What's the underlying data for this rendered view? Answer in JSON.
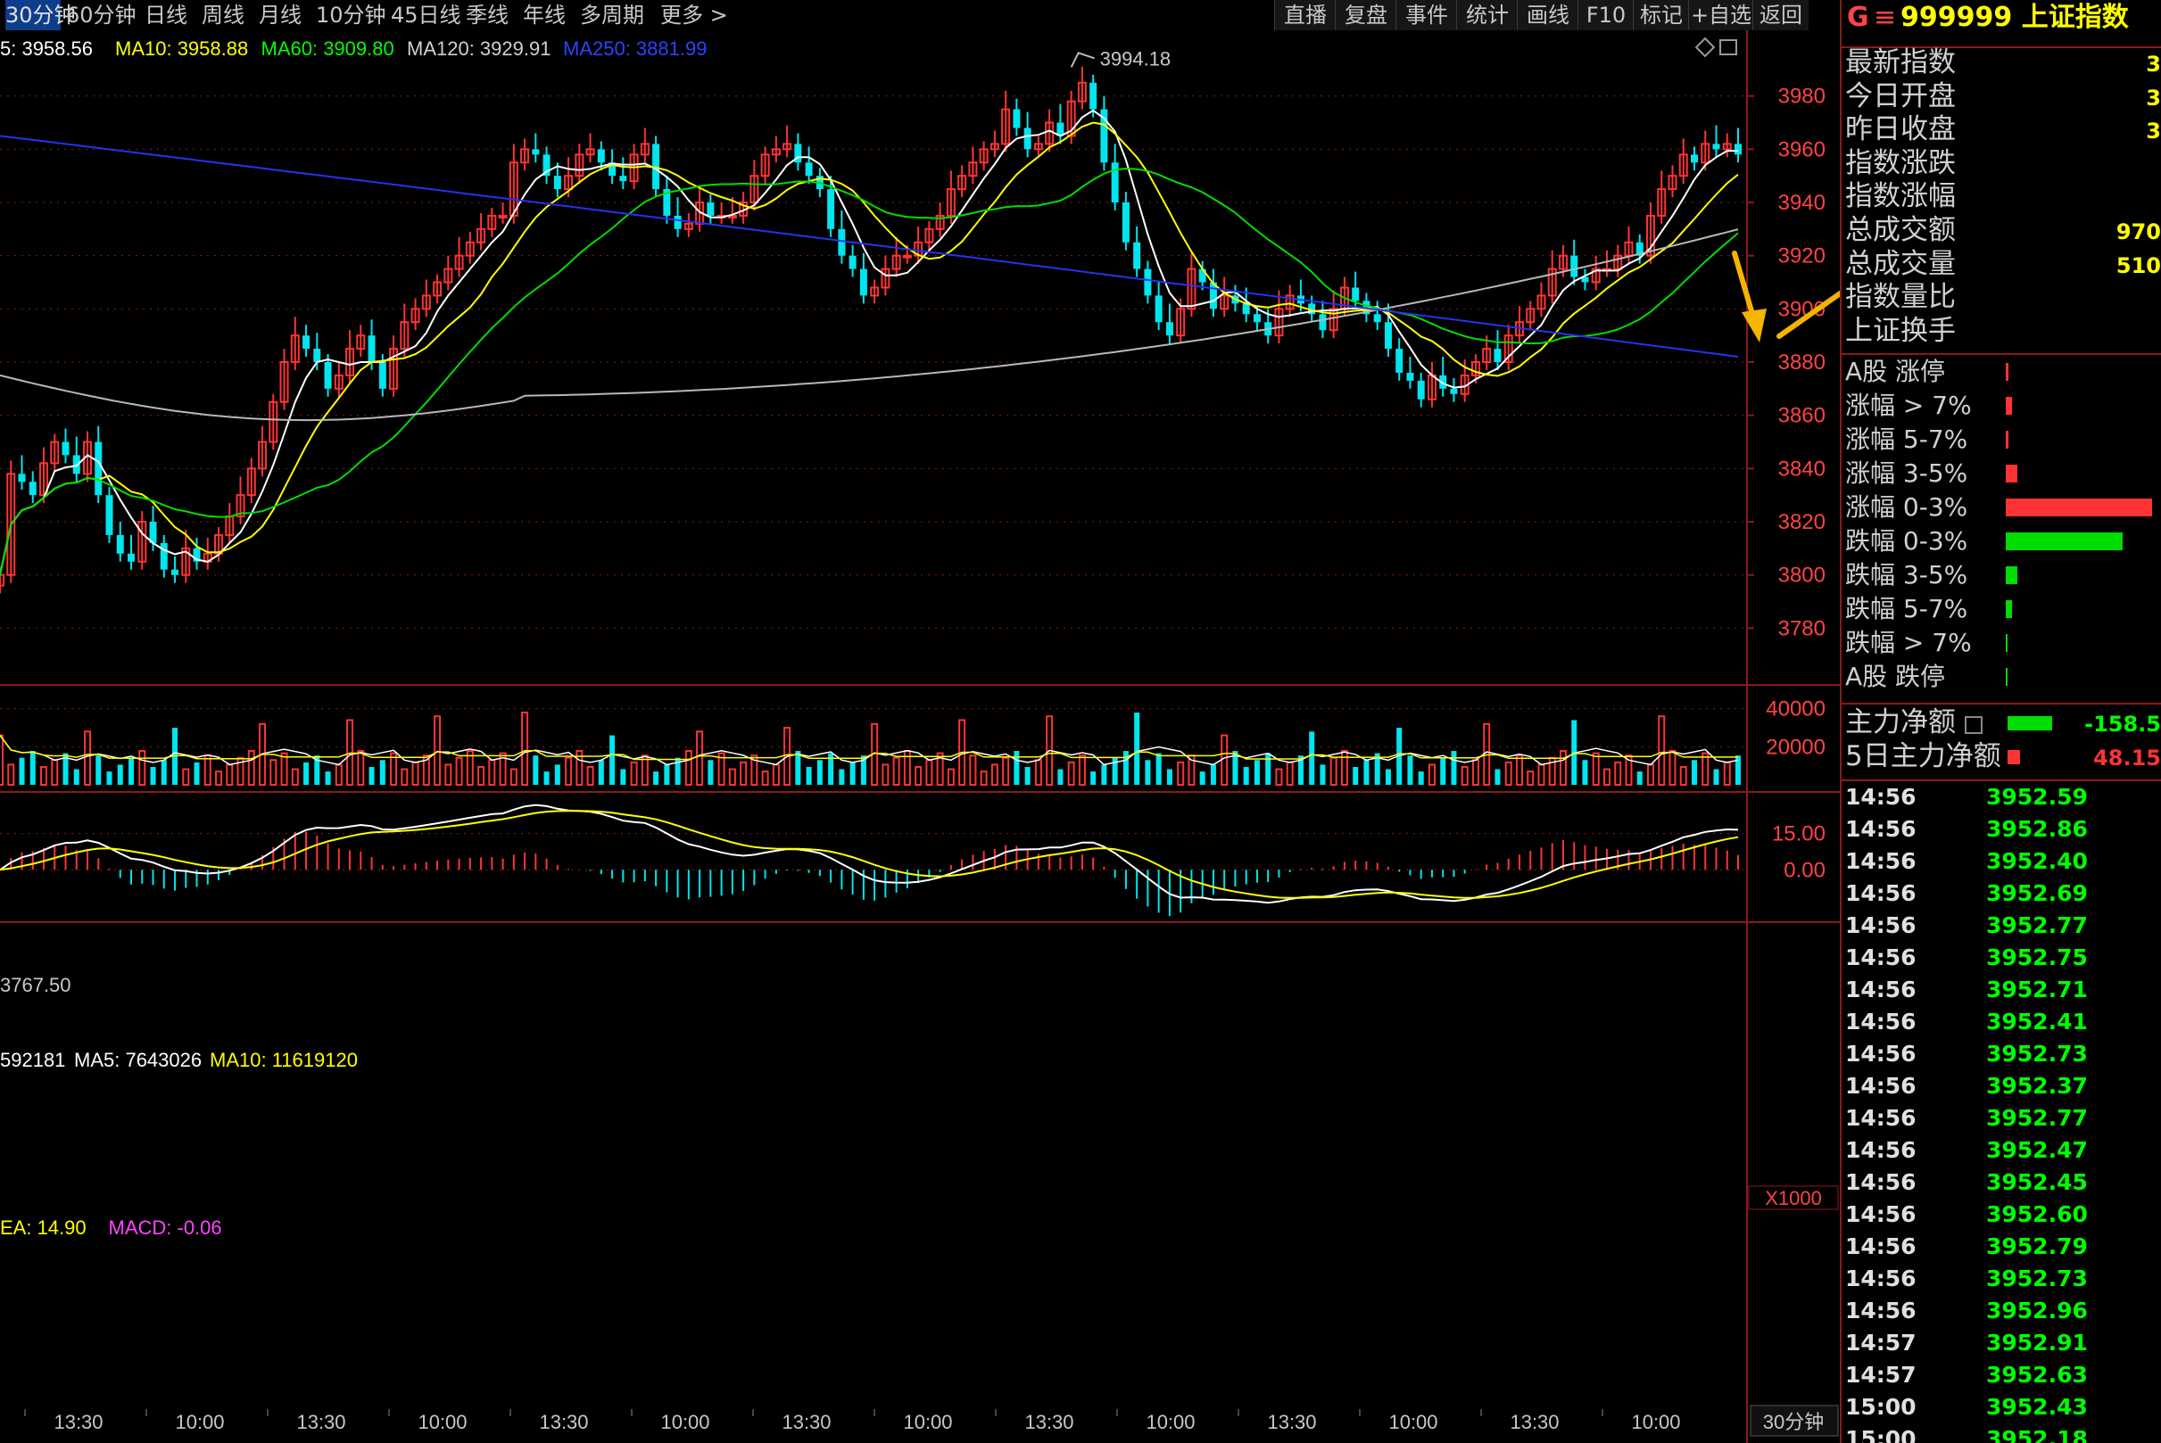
{
  "periods": [
    "30分钟",
    "60分钟",
    "日线",
    "周线",
    "月线",
    "10分钟",
    "45日线",
    "季线",
    "年线",
    "多周期",
    "更多 >"
  ],
  "active_period": "30分钟",
  "tools": [
    "直播",
    "复盘",
    "事件",
    "统计",
    "画线",
    "F10",
    "标记",
    "+自选",
    "返回"
  ],
  "main_legend": [
    {
      "text": "5: 3958.56",
      "color": "#ffffff"
    },
    {
      "text": "MA10: 3958.88",
      "color": "#ffff00"
    },
    {
      "text": "MA60: 3909.80",
      "color": "#00ff00"
    },
    {
      "text": "MA120: 3929.91",
      "color": "#d0d0d0"
    },
    {
      "text": "MA250: 3881.99",
      "color": "#2a44ff"
    }
  ],
  "high_label": "3994.18",
  "low_label": "3767.50",
  "price_ticks": [
    "3980",
    "3960",
    "3940",
    "3920",
    "3900",
    "3880",
    "3860",
    "3840",
    "3820",
    "3800",
    "3780"
  ],
  "vol_legend": [
    {
      "text": "592181",
      "color": "#ffffff"
    },
    {
      "text": "MA5: 7643026",
      "color": "#ffffff"
    },
    {
      "text": "MA10: 11619120",
      "color": "#ffff00"
    }
  ],
  "vol_ticks": [
    "40000",
    "20000"
  ],
  "vol_unit": "X1000",
  "macd_legend": [
    {
      "text": "EA: 14.90",
      "color": "#ffff00"
    },
    {
      "text": "MACD: -0.06",
      "color": "#ff44ff"
    }
  ],
  "macd_ticks": [
    "15.00",
    "0.00"
  ],
  "time_labels": [
    "13:30",
    "10:00",
    "13:30",
    "10:00",
    "13:30",
    "10:00",
    "13:30",
    "10:00",
    "13:30",
    "10:00",
    "13:30",
    "10:00",
    "13:30",
    "10:00"
  ],
  "period_label": "30分钟",
  "panel": {
    "title_letter": "G",
    "title_menu": "≡",
    "title": "999999 上证指数",
    "stats": [
      {
        "label": "最新指数",
        "value": "3"
      },
      {
        "label": "今日开盘",
        "value": "3"
      },
      {
        "label": "昨日收盘",
        "value": "3"
      },
      {
        "label": "指数涨跌",
        "value": ""
      },
      {
        "label": "指数涨幅",
        "value": ""
      },
      {
        "label": "总成交额",
        "value": "970"
      },
      {
        "label": "总成交量",
        "value": "510"
      },
      {
        "label": "指数量比",
        "value": ""
      },
      {
        "label": "上证换手",
        "value": ""
      }
    ],
    "distribution": [
      {
        "label": "A股 涨停",
        "frac": 0.02,
        "color": "#ff3333"
      },
      {
        "label": "涨幅 > 7%",
        "frac": 0.04,
        "color": "#ff3333"
      },
      {
        "label": "涨幅 5-7%",
        "frac": 0.02,
        "color": "#ff3333"
      },
      {
        "label": "涨幅 3-5%",
        "frac": 0.08,
        "color": "#ff3333"
      },
      {
        "label": "涨幅 0-3%",
        "frac": 1.0,
        "color": "#ff3333"
      },
      {
        "label": "跌幅 0-3%",
        "frac": 0.8,
        "color": "#00dd00"
      },
      {
        "label": "跌幅 3-5%",
        "frac": 0.08,
        "color": "#00dd00"
      },
      {
        "label": "跌幅 5-7%",
        "frac": 0.04,
        "color": "#00dd00"
      },
      {
        "label": "跌幅 > 7%",
        "frac": 0.01,
        "color": "#00dd00"
      },
      {
        "label": "A股 跌停",
        "frac": 0.01,
        "color": "#00dd00"
      }
    ],
    "main_net": {
      "label": "主力净额",
      "value": "-158.5"
    },
    "main_net_5d": {
      "label": "5日主力净额",
      "value": "48.15"
    },
    "ticks": [
      {
        "time": "14:56",
        "price": "3952.59"
      },
      {
        "time": "14:56",
        "price": "3952.86"
      },
      {
        "time": "14:56",
        "price": "3952.40"
      },
      {
        "time": "14:56",
        "price": "3952.69"
      },
      {
        "time": "14:56",
        "price": "3952.77"
      },
      {
        "time": "14:56",
        "price": "3952.75"
      },
      {
        "time": "14:56",
        "price": "3952.71"
      },
      {
        "time": "14:56",
        "price": "3952.41"
      },
      {
        "time": "14:56",
        "price": "3952.73"
      },
      {
        "time": "14:56",
        "price": "3952.37"
      },
      {
        "time": "14:56",
        "price": "3952.77"
      },
      {
        "time": "14:56",
        "price": "3952.47"
      },
      {
        "time": "14:56",
        "price": "3952.45"
      },
      {
        "time": "14:56",
        "price": "3952.60"
      },
      {
        "time": "14:56",
        "price": "3952.79"
      },
      {
        "time": "14:56",
        "price": "3952.73"
      },
      {
        "time": "14:56",
        "price": "3952.96"
      },
      {
        "time": "14:57",
        "price": "3952.91"
      },
      {
        "time": "14:57",
        "price": "3952.63"
      },
      {
        "time": "15:00",
        "price": "3952.43"
      },
      {
        "time": "15:00",
        "price": "3952.18"
      }
    ]
  },
  "colors": {
    "up": "#ff3333",
    "down": "#00e5ee",
    "grid": "#8b1a1a",
    "tick_green": "#00ff00",
    "arrow": "#f5b400"
  },
  "chart_data": {
    "type": "candlestick",
    "price_ylim": [
      3760,
      4000
    ],
    "closes": [
      3800,
      3838,
      3835,
      3830,
      3842,
      3850,
      3845,
      3838,
      3850,
      3830,
      3815,
      3808,
      3805,
      3820,
      3812,
      3802,
      3800,
      3810,
      3805,
      3808,
      3815,
      3822,
      3830,
      3840,
      3850,
      3865,
      3880,
      3890,
      3885,
      3880,
      3870,
      3875,
      3885,
      3890,
      3880,
      3870,
      3885,
      3895,
      3900,
      3905,
      3910,
      3915,
      3920,
      3925,
      3930,
      3935,
      3935,
      3955,
      3960,
      3958,
      3950,
      3945,
      3950,
      3958,
      3960,
      3955,
      3950,
      3948,
      3958,
      3962,
      3945,
      3935,
      3930,
      3932,
      3940,
      3935,
      3935,
      3935,
      3940,
      3950,
      3958,
      3960,
      3962,
      3955,
      3950,
      3945,
      3930,
      3920,
      3915,
      3905,
      3908,
      3915,
      3920,
      3920,
      3925,
      3930,
      3935,
      3945,
      3950,
      3955,
      3960,
      3962,
      3975,
      3968,
      3960,
      3962,
      3970,
      3965,
      3978,
      3985,
      3975,
      3955,
      3940,
      3925,
      3915,
      3905,
      3895,
      3890,
      3900,
      3915,
      3910,
      3900,
      3905,
      3902,
      3898,
      3895,
      3890,
      3900,
      3905,
      3902,
      3898,
      3892,
      3900,
      3908,
      3903,
      3898,
      3895,
      3885,
      3876,
      3873,
      3866,
      3875,
      3870,
      3868,
      3875,
      3880,
      3885,
      3880,
      3890,
      3895,
      3900,
      3905,
      3915,
      3920,
      3912,
      3910,
      3915,
      3915,
      3920,
      3925,
      3920,
      3935,
      3945,
      3950,
      3958,
      3955,
      3962,
      3960,
      3962,
      3958
    ],
    "ma_names": [
      "MA5",
      "MA10",
      "MA60",
      "MA120",
      "MA250"
    ],
    "ma_last": [
      3958.56,
      3958.88,
      3909.8,
      3929.91,
      3881.99
    ],
    "volume_ylim": [
      0,
      45000
    ],
    "macd_ylim": [
      -18,
      30
    ]
  }
}
